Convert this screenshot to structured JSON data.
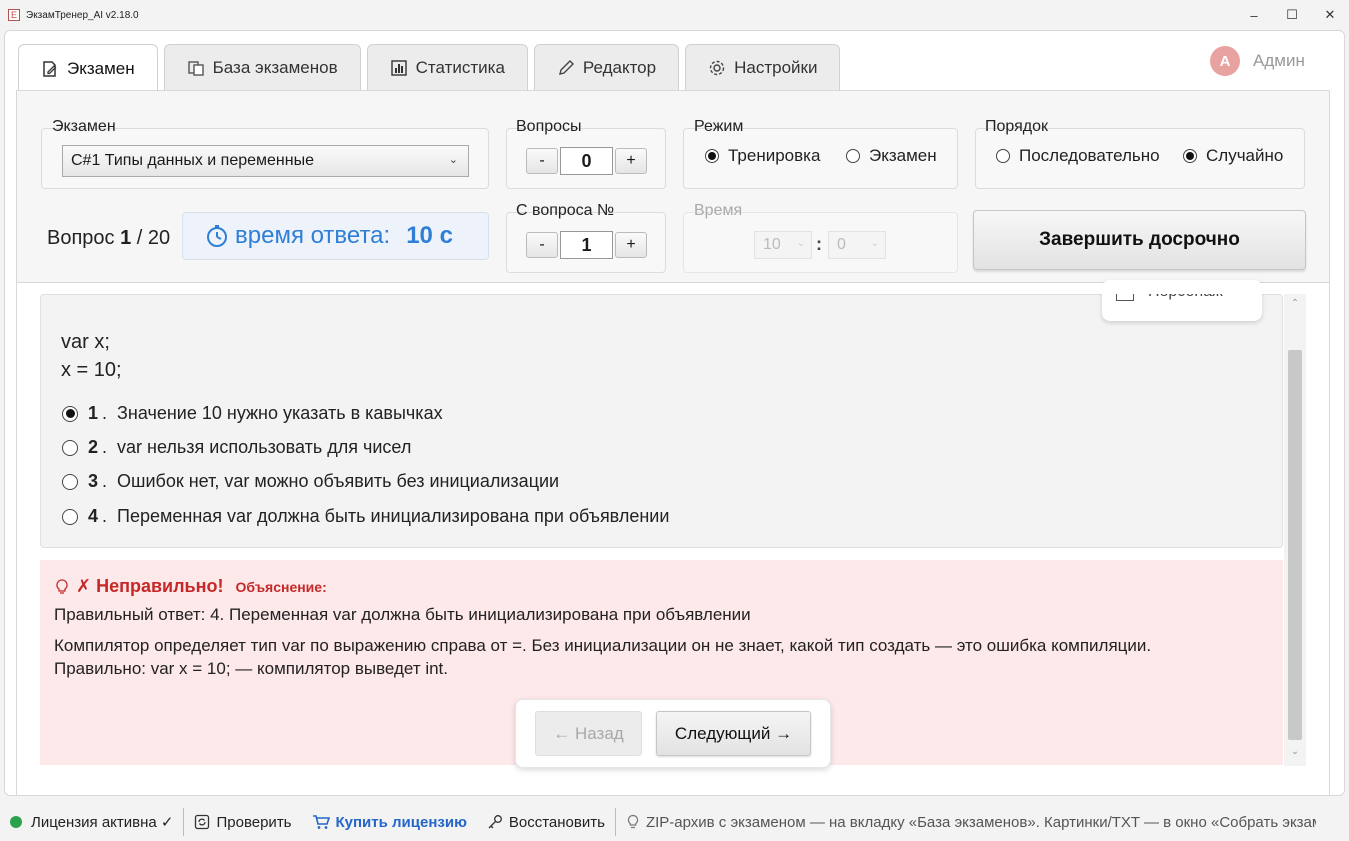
{
  "window": {
    "title": "ЭкзамТренер_AI v2.18.0",
    "min": "–",
    "max": "☐",
    "close": "✕"
  },
  "tabs": [
    {
      "label": "Экзамен",
      "icon": "edit-document-icon"
    },
    {
      "label": "База экзаменов",
      "icon": "copy-icon"
    },
    {
      "label": "Статистика",
      "icon": "bar-chart-icon"
    },
    {
      "label": "Редактор",
      "icon": "pencil-icon"
    },
    {
      "label": "Настройки",
      "icon": "gear-icon"
    }
  ],
  "user": {
    "initial": "А",
    "name": "Админ"
  },
  "controls": {
    "exam_label": "Экзамен",
    "exam_value": "C#1 Типы данных и переменные",
    "questions_label": "Вопросы",
    "questions_value": "0",
    "mode_label": "Режим",
    "mode_training": "Тренировка",
    "mode_exam": "Экзамен",
    "mode_selected": "Тренировка",
    "order_label": "Порядок",
    "order_sequential": "Последовательно",
    "order_random": "Случайно",
    "order_selected": "Случайно",
    "from_label": "С вопроса №",
    "from_value": "1",
    "time_label": "Время",
    "time_minutes": "10",
    "time_colon": ":",
    "time_seconds": "0",
    "minus": "-",
    "plus": "+",
    "finish_button": "Завершить досрочно"
  },
  "progress": {
    "prefix": "Вопрос",
    "current": "1",
    "slash": "/",
    "total": "20"
  },
  "timer": {
    "label": "время ответа:",
    "value": "10 с"
  },
  "question": {
    "code_line1": "var x;",
    "code_line2": "x = 10;",
    "persona_label": "Персонаж",
    "options": [
      {
        "num": "1",
        "text": "Значение 10 нужно указать в кавычках",
        "selected": true
      },
      {
        "num": "2",
        "text": "var нельзя использовать для чисел",
        "selected": false
      },
      {
        "num": "3",
        "text": "Ошибок нет, var можно объявить без инициализации",
        "selected": false
      },
      {
        "num": "4",
        "text": "Переменная var должна быть инициализирована при объявлении",
        "selected": false
      }
    ]
  },
  "feedback": {
    "status": "✗ Неправильно!",
    "explanation_label": "Объяснение:",
    "correct": "Правильный ответ: 4. Переменная var должна быть инициализирована при объявлении",
    "line1": "Компилятор определяет тип var по выражению справа от =. Без инициализации он не знает, какой тип создать — это ошибка компиляции.",
    "line2": "Правильно: var x = 10; — компилятор выведет int.",
    "status_color": "#c62828"
  },
  "nav": {
    "prev": "← Назад",
    "next": "Следующий →"
  },
  "statusbar": {
    "license": "Лицензия активна ✓",
    "check": "Проверить",
    "buy": "Купить лицензию",
    "restore": "Восстановить",
    "hint": "ZIP-архив с экзаменом — на вкладку «База экзаменов». Картинки/TXT — в окно «Собрать экзаме"
  },
  "colors": {
    "accent": "#2f7fd6",
    "error_bg": "#fde8ea",
    "license_ok": "#2ba24c",
    "link": "#2466c9"
  }
}
